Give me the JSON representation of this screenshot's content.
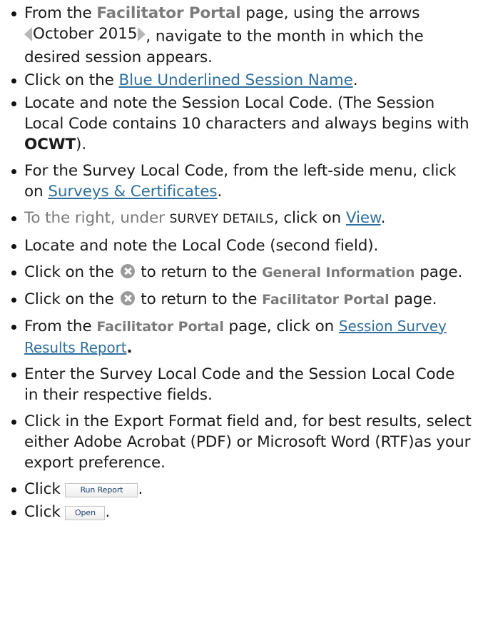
{
  "steps": {
    "s1": {
      "a": "From the ",
      "b": "Facilitator Portal",
      "c": " page, using the arrows ",
      "month": "October 2015",
      "d": ", navigate to the month in which the desired session appears."
    },
    "s2": {
      "a": "Click on the ",
      "link": "Blue Underlined Session Name",
      "b": "."
    },
    "s3": {
      "a": "Locate and note the ",
      "b": "Session Local Code",
      "c": ". (The Session Local Code contains 10 characters and always begins with ",
      "d": "OCWT",
      "e": ")."
    },
    "s4": {
      "a": "For the Survey Local Code, from the left-side menu, click on ",
      "link": "Surveys & Certificates",
      "b": "."
    },
    "s5": {
      "a": "To the right, under ",
      "b": "SURVEY DETAILS",
      "c": ", click on ",
      "link": "View",
      "d": "."
    },
    "s6": {
      "a": "Locate and note the ",
      "b": "Local Code",
      "c": " (second field)."
    },
    "s7": {
      "a": "Click on the ",
      "b": " to return to the ",
      "c": "General Information",
      "d": " page."
    },
    "s8": {
      "a": "Click on the ",
      "b": " to return to the ",
      "c": "Facilitator Portal",
      "d": " page."
    },
    "s9": {
      "a": "From the ",
      "b": "Facilitator Portal",
      "c": " page, click on ",
      "link": "Session Survey Results Report",
      "d": "."
    },
    "s10": {
      "a": "Enter the ",
      "b": "Survey Local Code",
      "c": " and the ",
      "d": "Session Local Code",
      "e": " in their respective fields."
    },
    "s11": {
      "a": "Click in the Export Format field and, for best results, select either Adobe Acrobat (PDF) or Microsoft Word (RTF)as your export preference."
    },
    "s12": {
      "a": "Click ",
      "button": "Run Report",
      "b": "."
    },
    "s13": {
      "a": "Click ",
      "button": "Open",
      "b": "."
    }
  },
  "icons": {
    "close": "close-circle-icon",
    "prev": "arrow-left-icon",
    "next": "arrow-right-icon"
  }
}
